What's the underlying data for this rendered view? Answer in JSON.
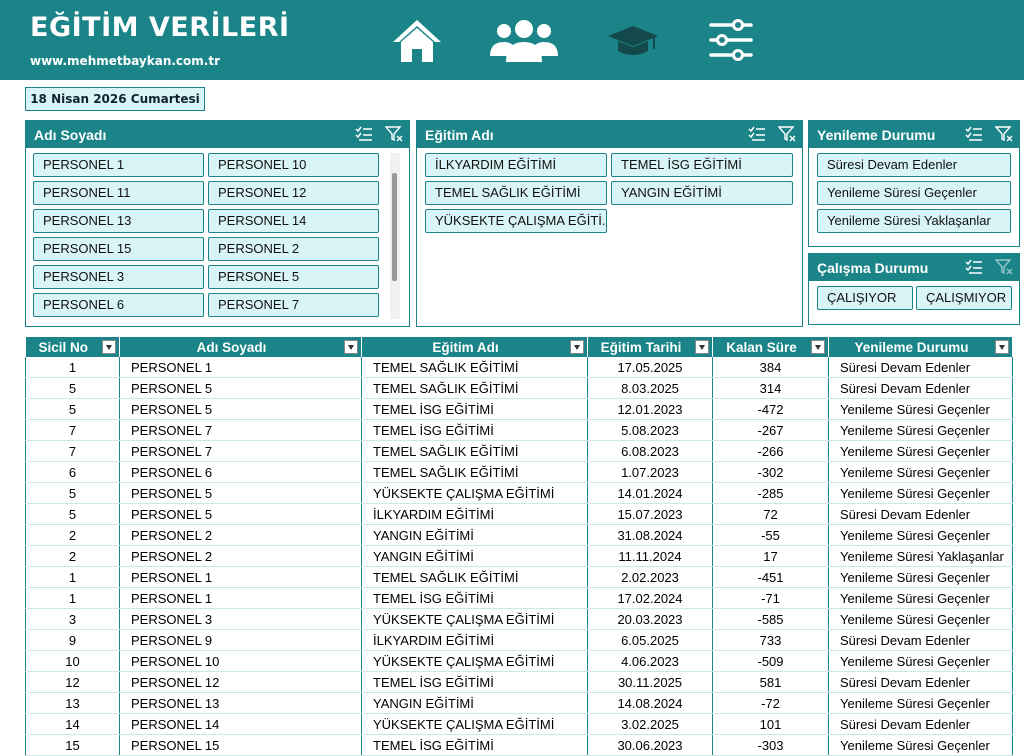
{
  "header": {
    "title": "EĞİTİM VERİLERİ",
    "website": "www.mehmetbaykan.com.tr",
    "nav_icons": [
      "home-icon",
      "people-icon",
      "graduation-cap-icon",
      "sliders-icon"
    ]
  },
  "date": "18 Nisan 2026 Cumartesi",
  "slicers": {
    "name": {
      "title": "Adı Soyadı",
      "items": [
        "PERSONEL 1",
        "PERSONEL 10",
        "PERSONEL 11",
        "PERSONEL 12",
        "PERSONEL 13",
        "PERSONEL 14",
        "PERSONEL 15",
        "PERSONEL 2",
        "PERSONEL 3",
        "PERSONEL 5",
        "PERSONEL 6",
        "PERSONEL 7"
      ]
    },
    "training": {
      "title": "Eğitim Adı",
      "items": [
        "İLKYARDIM EĞİTİMİ",
        "TEMEL İSG EĞİTİMİ",
        "TEMEL SAĞLIK EĞİTİMİ",
        "YANGIN EĞİTİMİ",
        "YÜKSEKTE ÇALIŞMA EĞİTİ..."
      ]
    },
    "renewal": {
      "title": "Yenileme Durumu",
      "items": [
        "Süresi Devam Edenler",
        "Yenileme Süresi Geçenler",
        "Yenileme Süresi Yaklaşanlar"
      ]
    },
    "work": {
      "title": "Çalışma Durumu",
      "items": [
        "ÇALIŞIYOR",
        "ÇALIŞMIYOR"
      ]
    }
  },
  "table": {
    "headers": [
      "Sicil No",
      "Adı Soyadı",
      "Eğitim Adı",
      "Eğitim Tarihi",
      "Kalan Süre",
      "Yenileme Durumu"
    ],
    "rows": [
      [
        "1",
        "PERSONEL 1",
        "TEMEL SAĞLIK EĞİTİMİ",
        "17.05.2025",
        "384",
        "Süresi Devam Edenler"
      ],
      [
        "5",
        "PERSONEL 5",
        "TEMEL SAĞLIK EĞİTİMİ",
        "8.03.2025",
        "314",
        "Süresi Devam Edenler"
      ],
      [
        "5",
        "PERSONEL 5",
        "TEMEL İSG EĞİTİMİ",
        "12.01.2023",
        "-472",
        "Yenileme Süresi Geçenler"
      ],
      [
        "7",
        "PERSONEL 7",
        "TEMEL İSG EĞİTİMİ",
        "5.08.2023",
        "-267",
        "Yenileme Süresi Geçenler"
      ],
      [
        "7",
        "PERSONEL 7",
        "TEMEL SAĞLIK EĞİTİMİ",
        "6.08.2023",
        "-266",
        "Yenileme Süresi Geçenler"
      ],
      [
        "6",
        "PERSONEL 6",
        "TEMEL SAĞLIK EĞİTİMİ",
        "1.07.2023",
        "-302",
        "Yenileme Süresi Geçenler"
      ],
      [
        "5",
        "PERSONEL 5",
        "YÜKSEKTE ÇALIŞMA EĞİTİMİ",
        "14.01.2024",
        "-285",
        "Yenileme Süresi Geçenler"
      ],
      [
        "5",
        "PERSONEL 5",
        "İLKYARDIM EĞİTİMİ",
        "15.07.2023",
        "72",
        "Süresi Devam Edenler"
      ],
      [
        "2",
        "PERSONEL 2",
        "YANGIN EĞİTİMİ",
        "31.08.2024",
        "-55",
        "Yenileme Süresi Geçenler"
      ],
      [
        "2",
        "PERSONEL 2",
        "YANGIN EĞİTİMİ",
        "11.11.2024",
        "17",
        "Yenileme Süresi Yaklaşanlar"
      ],
      [
        "1",
        "PERSONEL 1",
        "TEMEL SAĞLIK EĞİTİMİ",
        "2.02.2023",
        "-451",
        "Yenileme Süresi Geçenler"
      ],
      [
        "1",
        "PERSONEL 1",
        "TEMEL İSG EĞİTİMİ",
        "17.02.2024",
        "-71",
        "Yenileme Süresi Geçenler"
      ],
      [
        "3",
        "PERSONEL 3",
        "YÜKSEKTE ÇALIŞMA EĞİTİMİ",
        "20.03.2023",
        "-585",
        "Yenileme Süresi Geçenler"
      ],
      [
        "9",
        "PERSONEL 9",
        "İLKYARDIM EĞİTİMİ",
        "6.05.2025",
        "733",
        "Süresi Devam Edenler"
      ],
      [
        "10",
        "PERSONEL 10",
        "YÜKSEKTE ÇALIŞMA EĞİTİMİ",
        "4.06.2023",
        "-509",
        "Yenileme Süresi Geçenler"
      ],
      [
        "12",
        "PERSONEL 12",
        "TEMEL İSG EĞİTİMİ",
        "30.11.2025",
        "581",
        "Süresi Devam Edenler"
      ],
      [
        "13",
        "PERSONEL 13",
        "YANGIN EĞİTİMİ",
        "14.08.2024",
        "-72",
        "Yenileme Süresi Geçenler"
      ],
      [
        "14",
        "PERSONEL 14",
        "YÜKSEKTE ÇALIŞMA EĞİTİMİ",
        "3.02.2025",
        "101",
        "Süresi Devam Edenler"
      ],
      [
        "15",
        "PERSONEL 15",
        "TEMEL İSG EĞİTİMİ",
        "30.06.2023",
        "-303",
        "Yenileme Süresi Geçenler"
      ]
    ]
  },
  "colors": {
    "brand": "#1a8489",
    "button_fill": "#d9f4f6"
  }
}
